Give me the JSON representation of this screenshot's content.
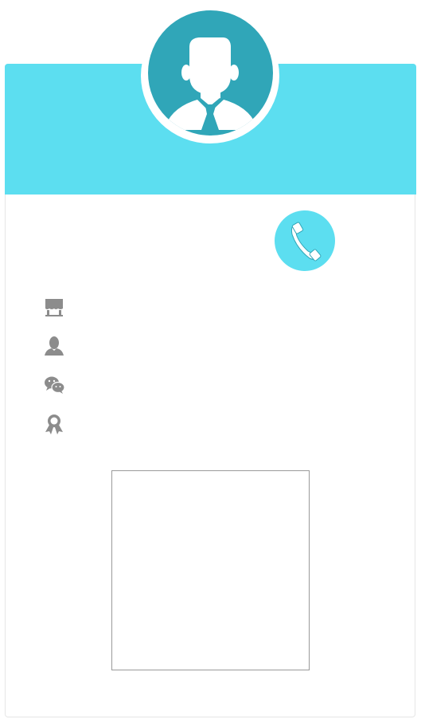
{
  "profile": {
    "avatar_icon": "businessman-avatar-icon",
    "accent_color": "#5cdef0",
    "avatar_color": "#30a6b8"
  },
  "call": {
    "icon": "phone-handset-icon"
  },
  "info_rows": [
    {
      "icon": "store-icon",
      "text": ""
    },
    {
      "icon": "person-icon",
      "text": ""
    },
    {
      "icon": "wechat-icon",
      "text": ""
    },
    {
      "icon": "award-ribbon-icon",
      "text": ""
    }
  ],
  "qr_code": {
    "icon": "qr-code-placeholder"
  }
}
